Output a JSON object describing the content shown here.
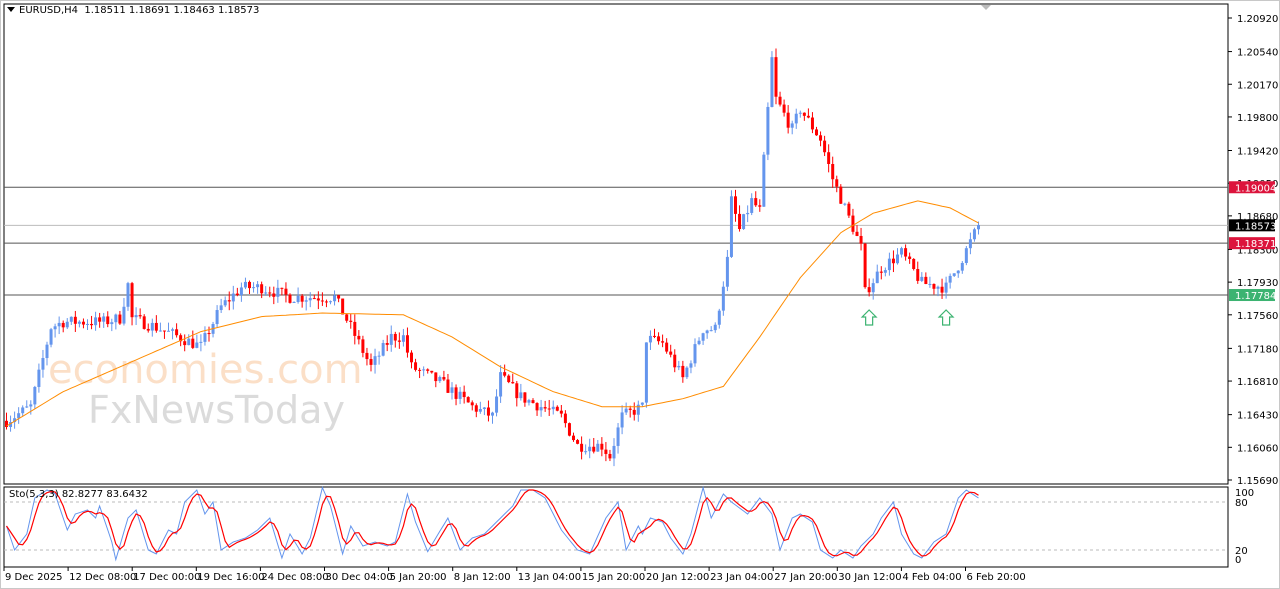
{
  "header": {
    "symbol": "EURUSD,H4",
    "ohlc": "1.18511 1.18691 1.18463 1.18573"
  },
  "colors": {
    "bull": "#6495ed",
    "bear": "#ff0000",
    "ma": "#ff8c00",
    "stoch_main": "#6495ed",
    "stoch_signal": "#ff0000",
    "level_line": "#555555",
    "label_red": "#dc143c",
    "label_green": "#3cb371",
    "label_black": "#000000",
    "arrow": "#3cb371"
  },
  "chart_data": {
    "type": "candlestick",
    "title": "EURUSD,H4",
    "ylim": [
      1.1569,
      1.2092
    ],
    "y_ticks": [
      "1.20920",
      "1.20540",
      "1.20170",
      "1.19800",
      "1.19420",
      "1.19050",
      "1.18680",
      "1.18300",
      "1.17930",
      "1.17560",
      "1.17180",
      "1.16810",
      "1.16430",
      "1.16060",
      "1.15690"
    ],
    "x_ticks": [
      "9 Dec 2025",
      "12 Dec 08:00",
      "17 Dec 00:00",
      "19 Dec 16:00",
      "24 Dec 08:00",
      "30 Dec 04:00",
      "5 Jan 20:00",
      "8 Jan 12:00",
      "13 Jan 04:00",
      "15 Jan 20:00",
      "20 Jan 12:00",
      "23 Jan 04:00",
      "27 Jan 20:00",
      "30 Jan 12:00",
      "4 Feb 04:00",
      "6 Feb 20:00"
    ],
    "bar_count": 241,
    "price_path": [
      [
        0,
        1.1636
      ],
      [
        6,
        1.1652
      ],
      [
        11,
        1.1742
      ],
      [
        14,
        1.1748
      ],
      [
        24,
        1.1748
      ],
      [
        28,
        1.1752
      ],
      [
        30,
        1.179
      ],
      [
        31,
        1.1752
      ],
      [
        38,
        1.174
      ],
      [
        48,
        1.172
      ],
      [
        53,
        1.1765
      ],
      [
        58,
        1.1787
      ],
      [
        63,
        1.1787
      ],
      [
        70,
        1.1776
      ],
      [
        78,
        1.1776
      ],
      [
        81,
        1.1776
      ],
      [
        85,
        1.1742
      ],
      [
        90,
        1.1697
      ],
      [
        95,
        1.1731
      ],
      [
        98,
        1.1731
      ],
      [
        100,
        1.1697
      ],
      [
        107,
        1.168
      ],
      [
        115,
        1.1652
      ],
      [
        120,
        1.1641
      ],
      [
        122,
        1.1686
      ],
      [
        127,
        1.1663
      ],
      [
        137,
        1.1641
      ],
      [
        141,
        1.1608
      ],
      [
        147,
        1.1608
      ],
      [
        149,
        1.1596
      ],
      [
        152,
        1.1641
      ],
      [
        157,
        1.1652
      ],
      [
        158,
        1.1729
      ],
      [
        162,
        1.1724
      ],
      [
        167,
        1.1684
      ],
      [
        172,
        1.174
      ],
      [
        175,
        1.174
      ],
      [
        178,
        1.1818
      ],
      [
        179,
        1.1885
      ],
      [
        181,
        1.1852
      ],
      [
        184,
        1.1885
      ],
      [
        186,
        1.1874
      ],
      [
        189,
        1.2045
      ],
      [
        190,
        1.2
      ],
      [
        194,
        1.1966
      ],
      [
        196,
        1.1989
      ],
      [
        201,
        1.1955
      ],
      [
        204,
        1.191
      ],
      [
        206,
        1.1888
      ],
      [
        209,
        1.1855
      ],
      [
        211,
        1.1832
      ],
      [
        212,
        1.1781
      ],
      [
        216,
        1.1809
      ],
      [
        221,
        1.1826
      ],
      [
        226,
        1.1792
      ],
      [
        232,
        1.1787
      ],
      [
        236,
        1.182
      ],
      [
        240,
        1.1857
      ]
    ],
    "moving_average": [
      [
        0,
        1.163
      ],
      [
        14,
        1.1669
      ],
      [
        28,
        1.1697
      ],
      [
        48,
        1.1737
      ],
      [
        63,
        1.1754
      ],
      [
        78,
        1.1758
      ],
      [
        98,
        1.1756
      ],
      [
        110,
        1.1731
      ],
      [
        122,
        1.1697
      ],
      [
        135,
        1.1669
      ],
      [
        147,
        1.1652
      ],
      [
        157,
        1.1652
      ],
      [
        167,
        1.1661
      ],
      [
        177,
        1.1675
      ],
      [
        186,
        1.1731
      ],
      [
        196,
        1.1798
      ],
      [
        206,
        1.1849
      ],
      [
        214,
        1.1871
      ],
      [
        225,
        1.1885
      ],
      [
        233,
        1.1877
      ],
      [
        240,
        1.186
      ]
    ],
    "horizontal_levels": [
      {
        "price": "1.19004",
        "label_color": "#dc143c"
      },
      {
        "price": "1.18573",
        "label_color": "#000000",
        "current": true
      },
      {
        "price": "1.18371",
        "label_color": "#dc143c"
      },
      {
        "price": "1.17784",
        "label_color": "#3cb371"
      }
    ],
    "arrows": [
      {
        "type": "up",
        "bar": 213
      },
      {
        "type": "up",
        "bar": 232
      }
    ],
    "indicator": {
      "label": "Sto(5,3,3) 82.8277 83.6432",
      "name": "Sto(5,3,3)",
      "main": 82.8277,
      "signal": 83.6432,
      "levels": [
        20,
        80
      ],
      "y_ticks": [
        "100",
        "80",
        "20",
        "0"
      ],
      "main_path": [
        [
          0,
          50
        ],
        [
          2,
          20
        ],
        [
          5,
          40
        ],
        [
          7,
          85
        ],
        [
          10,
          95
        ],
        [
          12,
          90
        ],
        [
          14,
          60
        ],
        [
          15,
          45
        ],
        [
          17,
          65
        ],
        [
          20,
          70
        ],
        [
          22,
          60
        ],
        [
          23,
          75
        ],
        [
          26,
          30
        ],
        [
          27,
          8
        ],
        [
          30,
          60
        ],
        [
          32,
          70
        ],
        [
          35,
          20
        ],
        [
          37,
          15
        ],
        [
          40,
          45
        ],
        [
          42,
          40
        ],
        [
          44,
          80
        ],
        [
          47,
          95
        ],
        [
          49,
          65
        ],
        [
          51,
          80
        ],
        [
          53,
          20
        ],
        [
          56,
          30
        ],
        [
          59,
          35
        ],
        [
          62,
          45
        ],
        [
          63,
          50
        ],
        [
          65,
          60
        ],
        [
          68,
          10
        ],
        [
          70,
          40
        ],
        [
          73,
          15
        ],
        [
          75,
          35
        ],
        [
          78,
          98
        ],
        [
          80,
          75
        ],
        [
          83,
          15
        ],
        [
          85,
          50
        ],
        [
          88,
          25
        ],
        [
          91,
          30
        ],
        [
          94,
          25
        ],
        [
          96,
          30
        ],
        [
          99,
          90
        ],
        [
          101,
          55
        ],
        [
          104,
          18
        ],
        [
          106,
          35
        ],
        [
          109,
          60
        ],
        [
          112,
          20
        ],
        [
          115,
          35
        ],
        [
          118,
          40
        ],
        [
          122,
          60
        ],
        [
          125,
          75
        ],
        [
          127,
          95
        ],
        [
          130,
          95
        ],
        [
          133,
          85
        ],
        [
          137,
          45
        ],
        [
          141,
          20
        ],
        [
          144,
          15
        ],
        [
          148,
          60
        ],
        [
          151,
          80
        ],
        [
          153,
          20
        ],
        [
          156,
          50
        ],
        [
          157,
          40
        ],
        [
          159,
          60
        ],
        [
          162,
          55
        ],
        [
          164,
          35
        ],
        [
          167,
          15
        ],
        [
          169,
          40
        ],
        [
          172,
          98
        ],
        [
          174,
          60
        ],
        [
          177,
          90
        ],
        [
          179,
          80
        ],
        [
          183,
          65
        ],
        [
          186,
          85
        ],
        [
          189,
          65
        ],
        [
          191,
          20
        ],
        [
          194,
          60
        ],
        [
          196,
          65
        ],
        [
          199,
          55
        ],
        [
          201,
          20
        ],
        [
          204,
          10
        ],
        [
          206,
          20
        ],
        [
          209,
          10
        ],
        [
          211,
          25
        ],
        [
          214,
          40
        ],
        [
          216,
          60
        ],
        [
          219,
          80
        ],
        [
          221,
          40
        ],
        [
          224,
          15
        ],
        [
          226,
          10
        ],
        [
          229,
          30
        ],
        [
          232,
          40
        ],
        [
          235,
          85
        ],
        [
          237,
          95
        ],
        [
          240,
          85
        ]
      ]
    }
  },
  "watermark": {
    "brand1": "economies.com",
    "brand2": "FxNewsToday"
  }
}
